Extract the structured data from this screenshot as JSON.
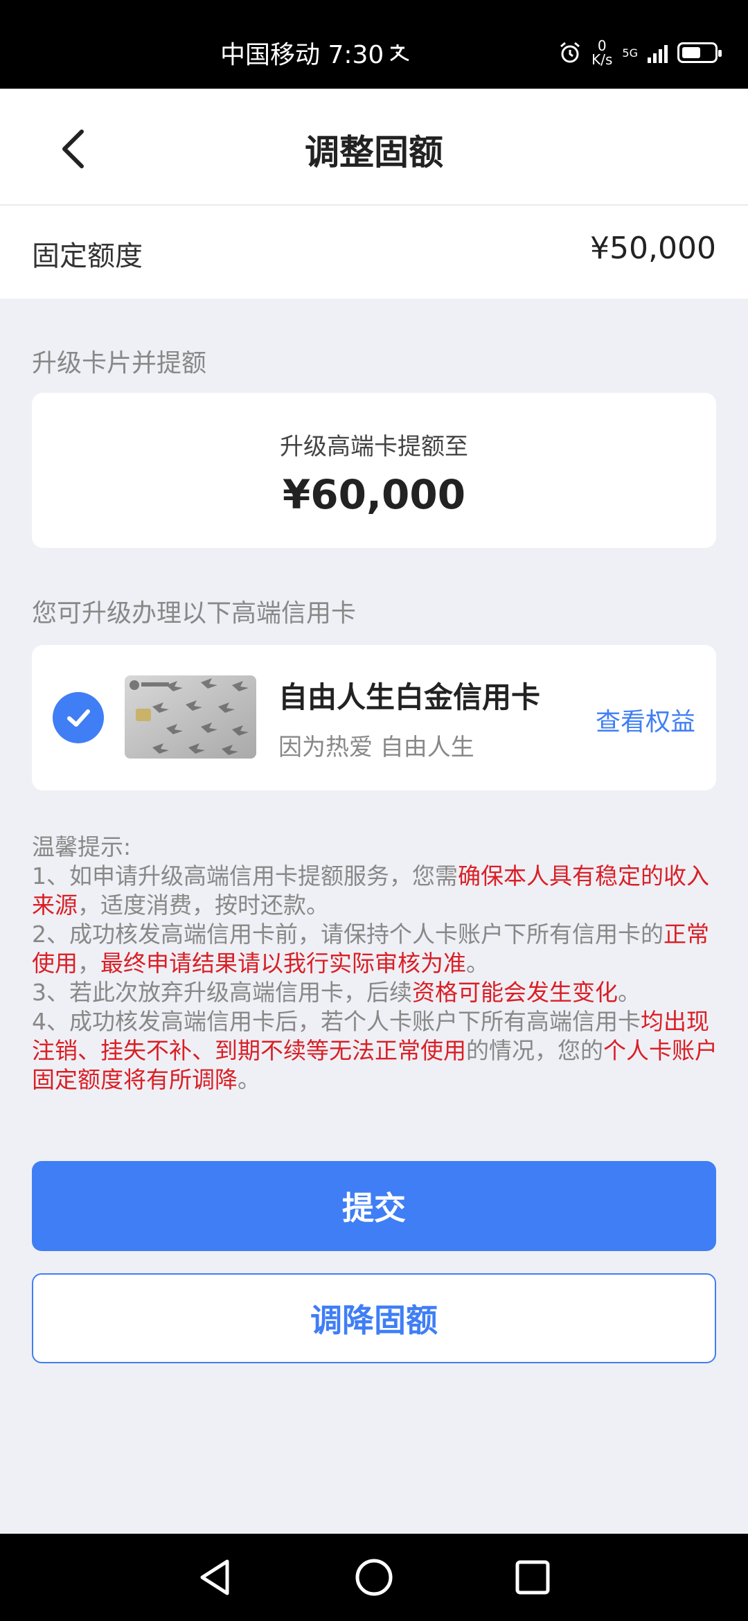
{
  "status_bar": {
    "carrier_time": "中国移动 7:30",
    "net_speed_value": "0",
    "net_speed_unit": "K/s",
    "network": "5G"
  },
  "header": {
    "title": "调整固额"
  },
  "fixed_limit": {
    "label": "固定额度",
    "value": "¥50,000"
  },
  "upgrade_section": {
    "label": "升级卡片并提额",
    "subtitle": "升级高端卡提额至",
    "amount": "¥60,000"
  },
  "cards_section": {
    "label": "您可升级办理以下高端信用卡",
    "card": {
      "name": "自由人生白金信用卡",
      "slogan": "因为热爱 自由人生",
      "link": "查看权益",
      "selected": true
    }
  },
  "tips": {
    "title": "温馨提示:",
    "l1a": "1、如申请升级高端信用卡提额服务，您需",
    "l1b": "确保本人具有稳定的收入来源",
    "l1c": "，适度消费，按时还款。",
    "l2a": "2、成功核发高端信用卡前，请保持个人卡账户下所有信用卡的",
    "l2b": "正常使用",
    "l2c": "，",
    "l2d": "最终申请结果请以我行实际审核为准",
    "l2e": "。",
    "l3a": "3、若此次放弃升级高端信用卡，后续",
    "l3b": "资格可能会发生变化",
    "l3c": "。",
    "l4a": "4、成功核发高端信用卡后，若个人卡账户下所有高端信用卡",
    "l4b": "均出现注销、挂失不补、到期不续等无法正常使用",
    "l4c": "的情况，您的",
    "l4d": "个人卡账户固定额度将有所调降",
    "l4e": "。"
  },
  "buttons": {
    "submit": "提交",
    "lower": "调降固额"
  },
  "colors": {
    "accent": "#3f7ef5",
    "warning": "#d91f26",
    "background": "#eff0f5"
  }
}
